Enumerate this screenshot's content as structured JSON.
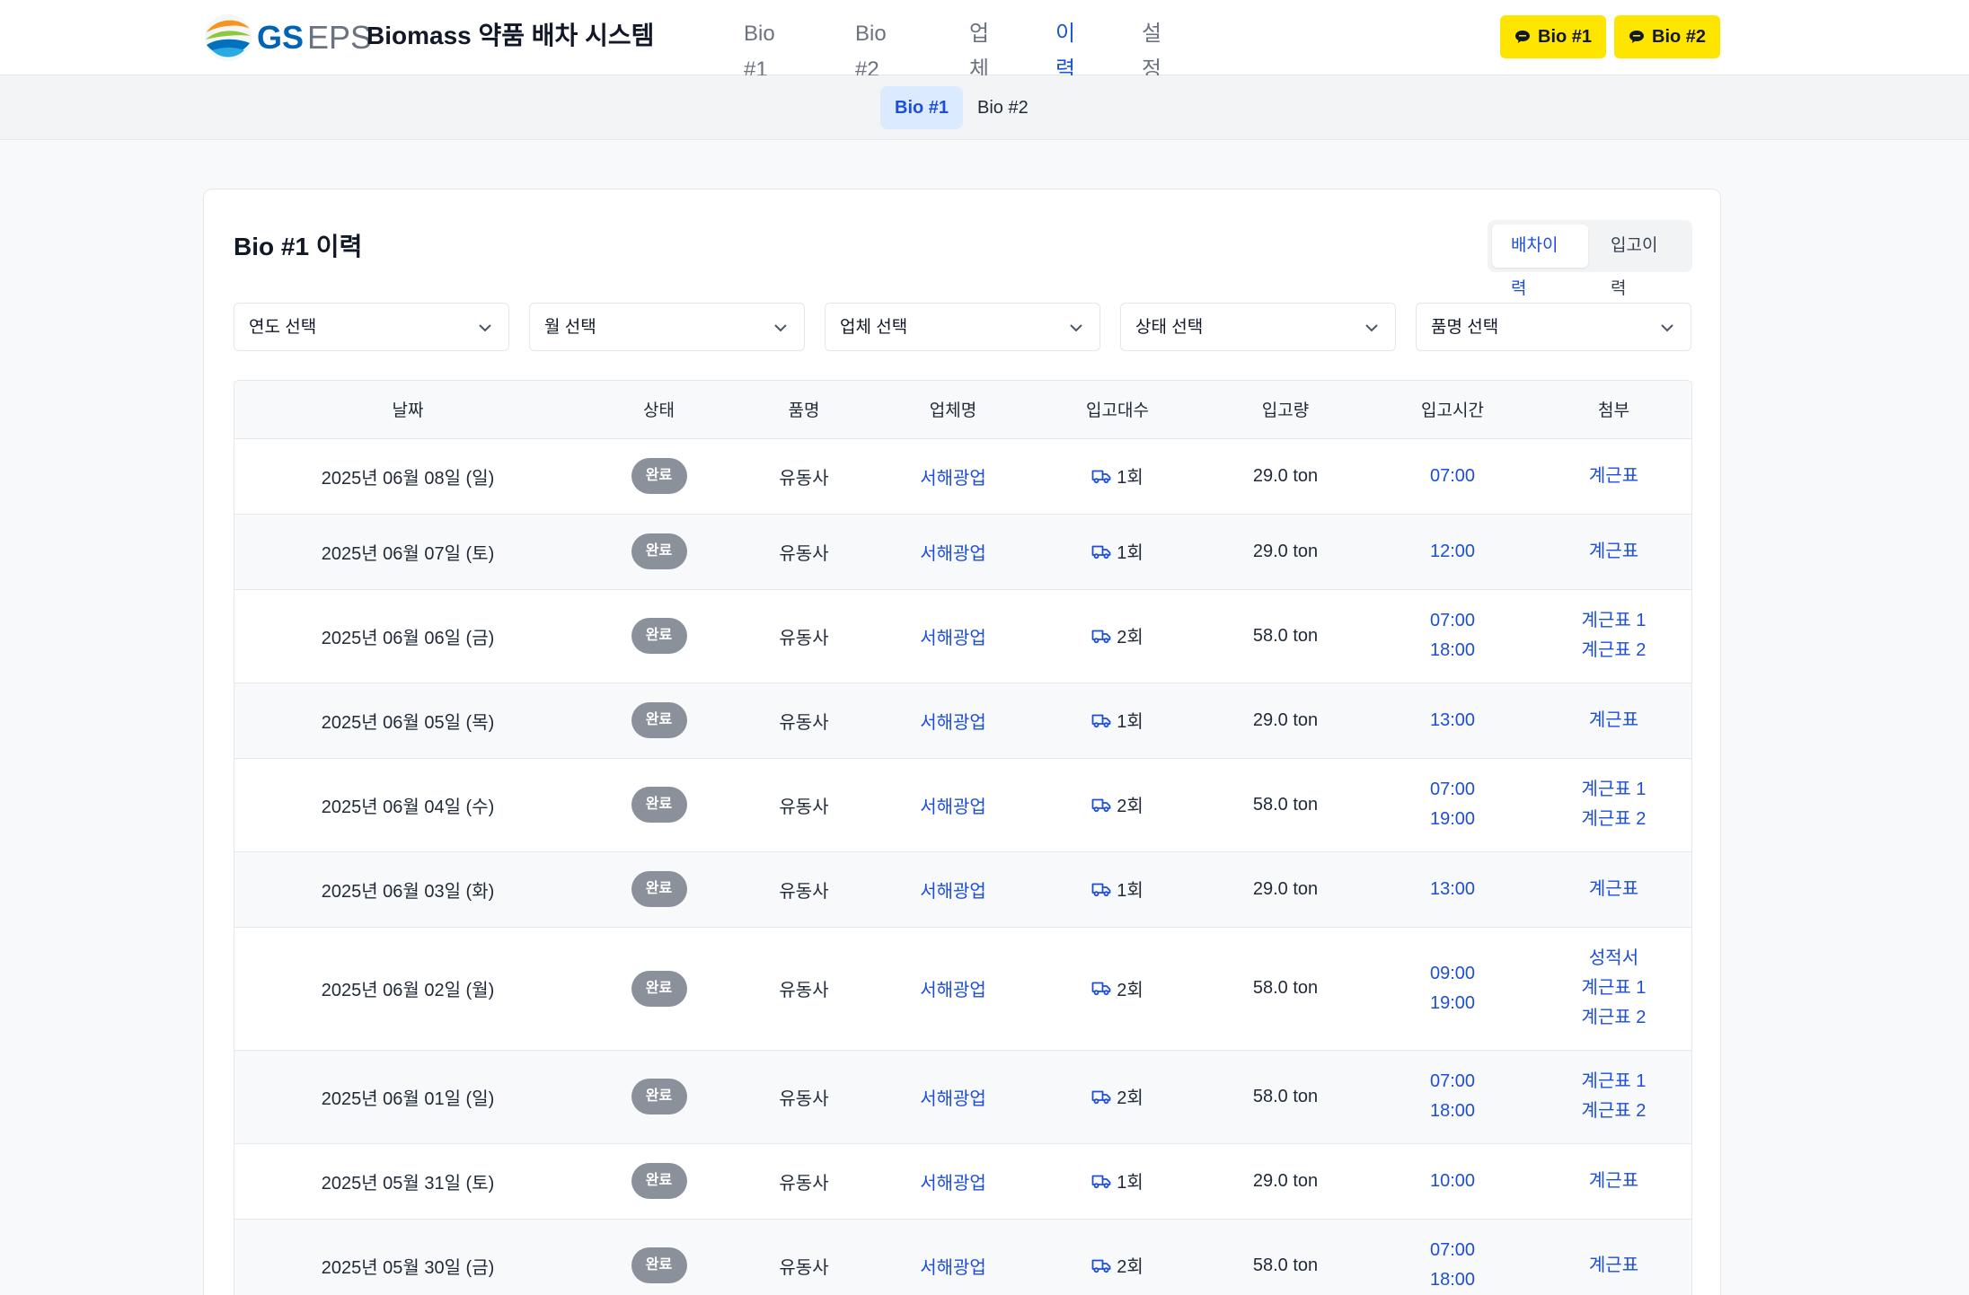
{
  "header": {
    "logo_gs": "GS",
    "logo_eps": "EPS",
    "app_title": "Biomass 약품 배차 시스템",
    "nav": [
      "Bio #1",
      "Bio #2",
      "업체",
      "이력",
      "설정"
    ],
    "active_nav": "이력",
    "kakao_buttons": [
      "Bio #1",
      "Bio #2"
    ],
    "accent_color": "#1a56db",
    "kakao_color": "#fee500"
  },
  "subnav": {
    "tabs": [
      "Bio #1",
      "Bio #2"
    ],
    "active": "Bio #1"
  },
  "card": {
    "title": "Bio #1 이력",
    "toggle": [
      "배차이력",
      "입고이력"
    ],
    "toggle_active": "배차이력",
    "filters": [
      "연도 선택",
      "월 선택",
      "업체 선택",
      "상태 선택",
      "품명 선택"
    ]
  },
  "table": {
    "columns": [
      "날짜",
      "상태",
      "품명",
      "업체명",
      "입고대수",
      "입고량",
      "입고시간",
      "첨부"
    ],
    "rows": [
      {
        "date": "2025년 06월 08일 (일)",
        "status": "완료",
        "item": "유동사",
        "vendor": "서해광업",
        "trips": "1회",
        "amount": "29.0 ton",
        "times": [
          "07:00"
        ],
        "attachments": [
          "계근표"
        ]
      },
      {
        "date": "2025년 06월 07일 (토)",
        "status": "완료",
        "item": "유동사",
        "vendor": "서해광업",
        "trips": "1회",
        "amount": "29.0 ton",
        "times": [
          "12:00"
        ],
        "attachments": [
          "계근표"
        ]
      },
      {
        "date": "2025년 06월 06일 (금)",
        "status": "완료",
        "item": "유동사",
        "vendor": "서해광업",
        "trips": "2회",
        "amount": "58.0 ton",
        "times": [
          "07:00",
          "18:00"
        ],
        "attachments": [
          "계근표 1",
          "계근표 2"
        ]
      },
      {
        "date": "2025년 06월 05일 (목)",
        "status": "완료",
        "item": "유동사",
        "vendor": "서해광업",
        "trips": "1회",
        "amount": "29.0 ton",
        "times": [
          "13:00"
        ],
        "attachments": [
          "계근표"
        ]
      },
      {
        "date": "2025년 06월 04일 (수)",
        "status": "완료",
        "item": "유동사",
        "vendor": "서해광업",
        "trips": "2회",
        "amount": "58.0 ton",
        "times": [
          "07:00",
          "19:00"
        ],
        "attachments": [
          "계근표 1",
          "계근표 2"
        ]
      },
      {
        "date": "2025년 06월 03일 (화)",
        "status": "완료",
        "item": "유동사",
        "vendor": "서해광업",
        "trips": "1회",
        "amount": "29.0 ton",
        "times": [
          "13:00"
        ],
        "attachments": [
          "계근표"
        ]
      },
      {
        "date": "2025년 06월 02일 (월)",
        "status": "완료",
        "item": "유동사",
        "vendor": "서해광업",
        "trips": "2회",
        "amount": "58.0 ton",
        "times": [
          "09:00",
          "19:00"
        ],
        "attachments": [
          "성적서",
          "계근표 1",
          "계근표 2"
        ]
      },
      {
        "date": "2025년 06월 01일 (일)",
        "status": "완료",
        "item": "유동사",
        "vendor": "서해광업",
        "trips": "2회",
        "amount": "58.0 ton",
        "times": [
          "07:00",
          "18:00"
        ],
        "attachments": [
          "계근표 1",
          "계근표 2"
        ]
      },
      {
        "date": "2025년 05월 31일 (토)",
        "status": "완료",
        "item": "유동사",
        "vendor": "서해광업",
        "trips": "1회",
        "amount": "29.0 ton",
        "times": [
          "10:00"
        ],
        "attachments": [
          "계근표"
        ]
      },
      {
        "date": "2025년 05월 30일 (금)",
        "status": "완료",
        "item": "유동사",
        "vendor": "서해광업",
        "trips": "2회",
        "amount": "58.0 ton",
        "times": [
          "07:00",
          "18:00"
        ],
        "attachments": [
          "계근표"
        ]
      }
    ]
  }
}
